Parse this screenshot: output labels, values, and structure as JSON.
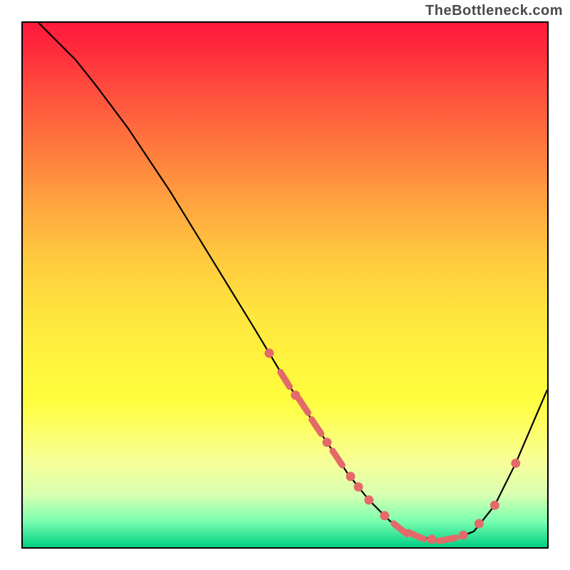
{
  "watermark": "TheBottleneck.com",
  "chart_data": {
    "type": "line",
    "title": "",
    "xlabel": "",
    "ylabel": "",
    "xlim": [
      0,
      100
    ],
    "ylim": [
      0,
      100
    ],
    "grid": false,
    "background": "red-yellow-green vertical gradient",
    "series": [
      {
        "name": "curve",
        "color": "#000000",
        "x": [
          3,
          6,
          10,
          14,
          20,
          28,
          36,
          44,
          50,
          54,
          58,
          60,
          62,
          66,
          70,
          74,
          78,
          82,
          86,
          90,
          94,
          100
        ],
        "y": [
          100,
          97,
          93,
          88,
          80,
          68,
          55,
          42,
          32,
          26,
          20,
          17,
          14,
          9,
          5,
          2.5,
          1.5,
          1.5,
          3,
          8,
          16,
          30
        ]
      }
    ],
    "highlighted_points": {
      "comment": "pink dot and dash markers along the curve",
      "color": "#e46a6a",
      "points": [
        {
          "x": 47,
          "y": 37,
          "shape": "dot"
        },
        {
          "x": 50,
          "y": 32,
          "shape": "dash"
        },
        {
          "x": 52,
          "y": 29,
          "shape": "dot"
        },
        {
          "x": 53.5,
          "y": 27,
          "shape": "dash"
        },
        {
          "x": 56,
          "y": 23,
          "shape": "dash"
        },
        {
          "x": 58,
          "y": 20,
          "shape": "dot"
        },
        {
          "x": 60,
          "y": 17,
          "shape": "dash"
        },
        {
          "x": 62.5,
          "y": 13.5,
          "shape": "dot"
        },
        {
          "x": 64,
          "y": 11.5,
          "shape": "dot"
        },
        {
          "x": 66,
          "y": 9,
          "shape": "dot"
        },
        {
          "x": 69,
          "y": 6,
          "shape": "dot"
        },
        {
          "x": 72,
          "y": 3.5,
          "shape": "dash"
        },
        {
          "x": 75,
          "y": 2.2,
          "shape": "dash"
        },
        {
          "x": 78,
          "y": 1.5,
          "shape": "dot"
        },
        {
          "x": 81,
          "y": 1.5,
          "shape": "dash"
        },
        {
          "x": 84,
          "y": 2.3,
          "shape": "dot"
        },
        {
          "x": 87,
          "y": 4.5,
          "shape": "dot"
        },
        {
          "x": 90,
          "y": 8,
          "shape": "dot"
        },
        {
          "x": 94,
          "y": 16,
          "shape": "dot"
        }
      ]
    }
  }
}
